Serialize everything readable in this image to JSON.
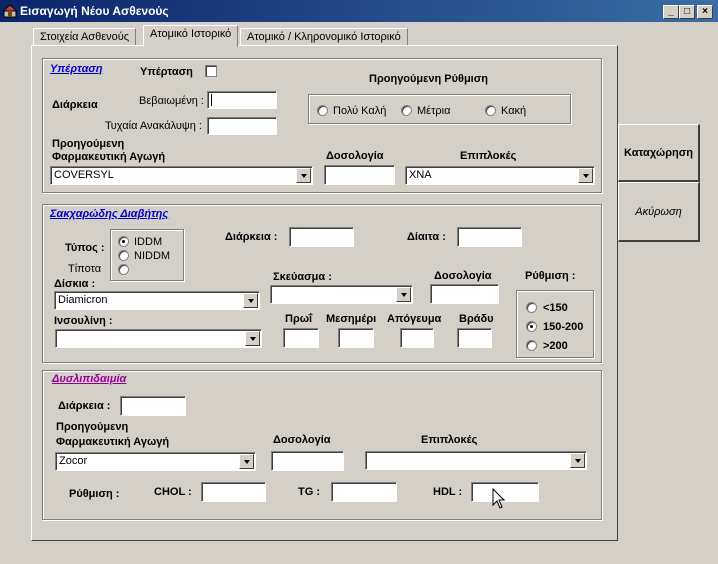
{
  "window": {
    "title": "Εισαγωγή Νέου Ασθενούς",
    "min": "_",
    "max": "□",
    "close": "×"
  },
  "tabs": [
    {
      "label": "Στοιχεία Ασθενούς"
    },
    {
      "label": "Ατομικό Ιστορικό"
    },
    {
      "label": "Ατομικό / Κληρονομικό Ιστορικό"
    }
  ],
  "hypertension": {
    "title": "Υπέρταση",
    "checkbox_label": "Υπέρταση",
    "duration_label": "Διάρκεια",
    "confirmed_label": "Βεβαιωμένη :",
    "confirmed_value": "",
    "incidental_label": "Τυχαία Ανακάλυψη :",
    "incidental_value": "",
    "prev_regulation_label": "Προηγούμενη Ρύθμιση",
    "options": [
      "Πολύ Καλή",
      "Μέτρια",
      "Κακή"
    ],
    "prev_drug_label_1": "Προηγούμενη",
    "prev_drug_label_2": "Φαρμακευτική Αγωγή",
    "drug_value": "COVERSYL",
    "dosage_label": "Δοσολογία",
    "dosage_value": "",
    "complications_label": "Επιπλοκές",
    "complications_value": "XNA"
  },
  "diabetes": {
    "title": "Σακχαρώδης Διαβήτης",
    "type_label": "Τύπος :",
    "type_options": [
      "IDDM",
      "NIDDM"
    ],
    "none_label": "Τίποτα",
    "duration_label": "Διάρκεια :",
    "duration_value": "",
    "diet_label": "Δίαιτα :",
    "diet_value": "",
    "tablets_label": "Δίσκια :",
    "tablets_value": "Diamicron",
    "preparation_label": "Σκεύασμα :",
    "preparation_value": "",
    "dosage_label": "Δοσολογία",
    "dosage_value": "",
    "insulin_label": "Ινσουλίνη :",
    "insulin_value": "",
    "morning_label": "Πρωΐ",
    "noon_label": "Μεσημέρι",
    "afternoon_label": "Απόγευμα",
    "evening_label": "Βράδυ",
    "regulation_label": "Ρύθμιση :",
    "regulation_options": [
      "<150",
      "150-200",
      ">200"
    ]
  },
  "dyslipidemia": {
    "title": "Δυσλιπιδαιμία",
    "duration_label": "Διάρκεια :",
    "duration_value": "",
    "prev_drug_label_1": "Προηγούμενη",
    "prev_drug_label_2": "Φαρμακευτική Αγωγή",
    "drug_value": "Zocor",
    "dosage_label": "Δοσολογία",
    "dosage_value": "",
    "complications_label": "Επιπλοκές",
    "complications_value": "",
    "regulation_label": "Ρύθμιση :",
    "chol_label": "CHOL :",
    "tg_label": "TG :",
    "hdl_label": "HDL :"
  },
  "buttons": {
    "save": "Καταχώρηση",
    "cancel": "Ακύρωση"
  }
}
